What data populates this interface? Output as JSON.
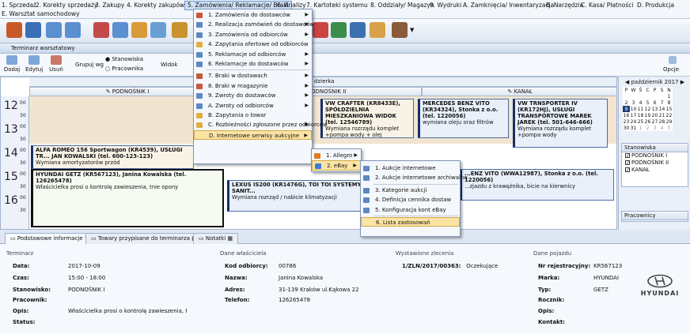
{
  "menubar": {
    "items": [
      "1. Sprzedaż",
      "2. Korekty sprzedaży",
      "3. Zakupy",
      "4. Korekty zakupów",
      "5. Zamówienia/ Reklamacje/ Braki",
      "6. Analizy",
      "7. Kartoteki systemu",
      "8. Oddziały/ Magazyn",
      "9. Wydruki",
      "A. Zamknięcia/ Inwentaryzacja",
      "B. Narzędzia",
      "C. Kasa/ Płatności",
      "D. Produkcja",
      "E. Warsztat samochodowy"
    ]
  },
  "window": {
    "title": "Terminarz warsztatowy"
  },
  "ribbon": {
    "buttons": [
      "Dodaj",
      "Edytuj",
      "Usuń"
    ],
    "group_label": "Grupuj wg",
    "radio1": "Stanowiska",
    "radio2": "Pracownika",
    "view_label": "Widok",
    "options": "Opcje"
  },
  "schedule": {
    "day_header": "dzierka",
    "columns": [
      "PODNOŚNIK I",
      "PODNOŚNIK II",
      "KANAŁ"
    ],
    "hours": [
      "12",
      "13",
      "14",
      "15",
      "16"
    ],
    "minutes": [
      "00",
      "30",
      "00",
      "30",
      "00",
      "30",
      "00",
      "30",
      "00",
      "30"
    ],
    "appointments": [
      {
        "title": "VW CRAFTER (KR8433E), SPÓŁDZIELNIA MIESZKANIOWA WIDOK (tel. 12546789)",
        "desc": "Wymiana rozrządu komplet +pompa wody + olej"
      },
      {
        "title": "MERCEDES BENZ VITO (KR34324), Stonka z o.o. (tel. 1220056)",
        "desc": "wymiana oleju oraz filtrów"
      },
      {
        "title": "VW TRNSPORTER IV (KR172HJ), USŁUGI TRANSPORTOWE MAREK JAREK (tel. 501-646-666)",
        "desc": "Wymiana rozrządu komplet +pompa wody"
      },
      {
        "title": "ALFA ROMEO 156 Sportwagon (KR4539), USŁUGI TR... JAN KOWALSKI (tel. 600-123-123)",
        "desc": "Wymiana amortyzatorów przód"
      },
      {
        "title": "HYUNDAI GETZ (KR567123), Janina Kowalska (tel. 126265478)",
        "desc": "Właścicielka prosi o kontrolę zawieszenia, tnie opony"
      },
      {
        "title": "LEXUS IS200 (KR1476G), TOI TOI SYSTEMY SANIT...",
        "desc": "Wymiana rozrząd / nabicie klimatyzacji"
      },
      {
        "title": "...ENZ VITO (WWA12987), Stonka z o.o. (tel. 1220056)",
        "desc": "...zjazdu z krawężnika, bicie na kierwnicy"
      }
    ]
  },
  "calendar": {
    "month": "październik 2017",
    "days": [
      "P",
      "W",
      "Ś",
      "C",
      "P",
      "S",
      "N"
    ],
    "weeks": [
      [
        "",
        "",
        "",
        "",
        "",
        "",
        "1"
      ],
      [
        "2",
        "3",
        "4",
        "5",
        "6",
        "7",
        "8"
      ],
      [
        "9",
        "10",
        "11",
        "12",
        "13",
        "14",
        "15"
      ],
      [
        "16",
        "17",
        "18",
        "19",
        "20",
        "21",
        "22"
      ],
      [
        "23",
        "24",
        "25",
        "26",
        "27",
        "28",
        "29"
      ],
      [
        "30",
        "31",
        "1",
        "2",
        "3",
        "4",
        "5"
      ]
    ]
  },
  "stanowiska": {
    "title": "Stanowiska",
    "items": [
      "PODNOŚNIK I",
      "PODNOŚNIK II",
      "KANAŁ"
    ]
  },
  "pracownicy": {
    "title": "Pracownicy"
  },
  "tabs": [
    "Podstawowe informacje",
    "Towary przypisane do terminarza",
    "Notatki"
  ],
  "details": {
    "terminarz": {
      "title": "Terminarz",
      "rows": [
        [
          "Data:",
          "2017-10-09"
        ],
        [
          "Czas:",
          "15:00 - 18:00"
        ],
        [
          "Stanowisko:",
          "PODNOŚNIK I"
        ],
        [
          "Pracownik:",
          ""
        ],
        [
          "Opis:",
          "Właścicielka prosi o kontrolę zawieszenia, tnie o..."
        ],
        [
          "Status:",
          ""
        ]
      ]
    },
    "wlasciciel": {
      "title": "Dane właściciela",
      "rows": [
        [
          "Kod odbiorcy:",
          "00786"
        ],
        [
          "Nazwa:",
          "Janina Kowalska"
        ],
        [
          "Adres:",
          "31-139 Kraków ul.Kąkowa 22"
        ],
        [
          "Telefon:",
          "126265478"
        ]
      ]
    },
    "zlecenie": {
      "title": "Wystawione zlecenia",
      "number": "1/ZLN/2017/00363:",
      "status": "Oczekujące"
    },
    "pojazd": {
      "title": "Dane pojazdu",
      "rows": [
        [
          "Nr rejestracyjny:",
          "KR567123"
        ],
        [
          "Marka:",
          "HYUNDAI"
        ],
        [
          "Typ:",
          "GETZ"
        ],
        [
          "Rocznik:",
          ""
        ],
        [
          "Opis:",
          ""
        ],
        [
          "Kontakt:",
          ""
        ]
      ],
      "logo": "HYUNDAI"
    }
  },
  "menu1": [
    "1. Zamówienia do dostawców",
    "2. Realizacja zamówień do dostawców",
    "3. Zamówienia od odbiorców",
    "4. Zapytania ofertowe od odbiorców",
    "5. Reklamacje od odbiorców",
    "6. Reklamacje do dostawców",
    "7. Braki w dostawach",
    "8. Braki w magazynie",
    "9. Zwroty do dostawców",
    "A. Zwroty od odbiorców",
    "B. Zapytania o towar",
    "C. Rozbieżności zgłoszone przez odbiorców",
    "D. Internetowe serwisy aukcyjne"
  ],
  "menu2": [
    "1. Allegro",
    "2. eBay"
  ],
  "menu3": [
    "1. Aukcje internetowe",
    "2. Aukcje internetowe archiwalne",
    "3. Kategorie aukcji",
    "4. Definicja cennika dostaw",
    "5. Konfiguracja kont eBay",
    "6. Lista zastosowań"
  ]
}
